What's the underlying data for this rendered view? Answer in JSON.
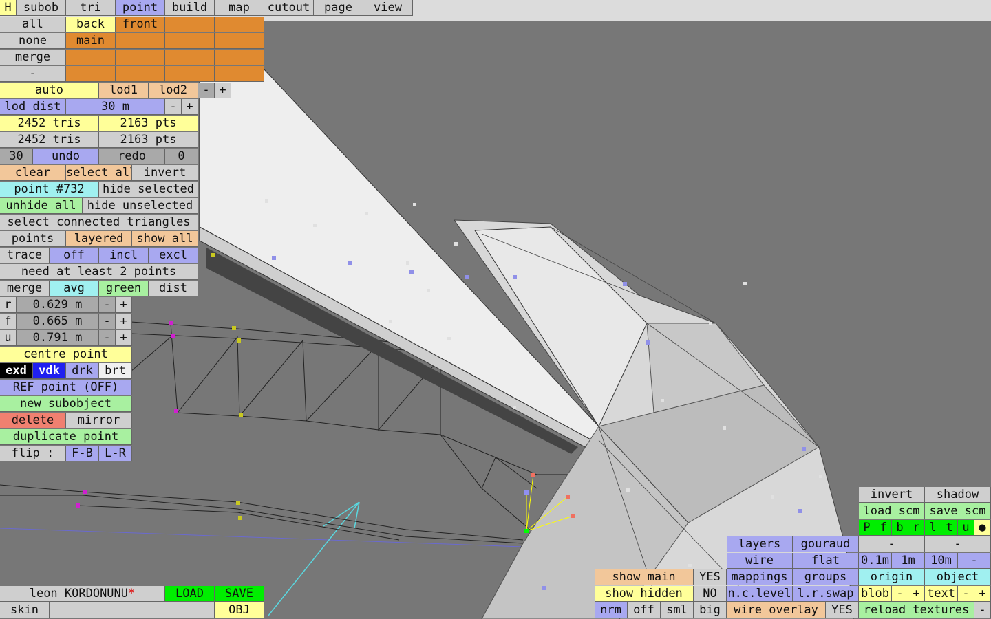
{
  "menu": [
    "H",
    "subob",
    "tri",
    "point",
    "build",
    "map",
    "cutout",
    "page",
    "view"
  ],
  "sel_panel": {
    "all": "all",
    "none": "none",
    "merge": "merge",
    "dash": "-",
    "back": "back",
    "front": "front",
    "main": "main"
  },
  "lod": {
    "auto": "auto",
    "lod1": "lod1",
    "lod2": "lod2",
    "minus": "-",
    "plus": "+"
  },
  "lod_dist": {
    "label": "lod dist",
    "value": "30 m",
    "minus": "-",
    "plus": "+"
  },
  "stats": {
    "tris1": "2452 tris",
    "pts1": "2163 pts",
    "tris2": "2452 tris",
    "pts2": "2163 pts"
  },
  "undo_row": {
    "count": "30",
    "undo": "undo",
    "redo": "redo",
    "zero": "0"
  },
  "select_row": {
    "clear": "clear",
    "select_all": "select all",
    "invert": "invert"
  },
  "point_row": {
    "point": "point #732",
    "hide_selected": "hide selected"
  },
  "unhide_row": {
    "unhide_all": "unhide all",
    "hide_unselected": "hide unselected"
  },
  "select_connected": "select connected triangles",
  "points_row": {
    "points": "points",
    "layered": "layered",
    "show_all": "show all"
  },
  "trace_row": {
    "trace": "trace",
    "off": "off",
    "incl": "incl",
    "excl": "excl"
  },
  "need_msg": "need at least 2 points",
  "merge_row": {
    "merge": "merge",
    "avg": "avg",
    "green": "green",
    "dist": "dist"
  },
  "coords": [
    {
      "axis": "r",
      "value": "0.629 m"
    },
    {
      "axis": "f",
      "value": "0.665 m"
    },
    {
      "axis": "u",
      "value": "0.791 m"
    }
  ],
  "pm": {
    "minus": "-",
    "plus": "+"
  },
  "centre_point": "centre point",
  "style_row": {
    "exd": "exd",
    "vdk": "vdk",
    "drk": "drk",
    "brt": "brt"
  },
  "ref_point": "REF point (OFF)",
  "new_subobject": "new subobject",
  "delete_row": {
    "delete": "delete",
    "mirror": "mirror"
  },
  "duplicate_point": "duplicate point",
  "flip_row": {
    "flip": "flip :",
    "fb": "F-B",
    "lr": "L-R"
  },
  "file": {
    "name": "leon KORDONUNU",
    "modified_mark": "*",
    "load": "LOAD",
    "save": "SAVE",
    "skin": "skin",
    "obj": "OBJ"
  },
  "show_panel": {
    "show_main": "show main",
    "yes": "YES",
    "show_hidden": "show hidden",
    "no": "NO",
    "nrm": "nrm",
    "off": "off",
    "sml": "sml",
    "big": "big"
  },
  "render_panel": {
    "layers": "layers",
    "gouraud": "gouraud",
    "wire": "wire",
    "flat": "flat",
    "mappings": "mappings",
    "groups": "groups",
    "nc_level": "n.c.level",
    "lr_swap": "l.r.swap",
    "wire_overlay": "wire overlay",
    "yes": "YES"
  },
  "right_panel": {
    "invert": "invert",
    "shadow": "shadow",
    "load_scm": "load scm",
    "save_scm": "save scm",
    "letters": [
      "P",
      "f",
      "b",
      "r",
      "l",
      "t",
      "u",
      "●"
    ],
    "dash1": "-",
    "dash2": "-",
    "s01": "0.1m",
    "s1": "1m",
    "s10": "10m",
    "sminus": "-",
    "origin": "origin",
    "object": "object",
    "blob": "blob",
    "text": "text",
    "minus": "-",
    "plus": "+",
    "reload": "reload textures",
    "rminus": "-"
  },
  "colors": {
    "orange": "#e08a30",
    "yellow": "#ffff99",
    "lavender": "#a8a8f0",
    "green": "#00ee00",
    "cyan": "#a0f0f0",
    "background": "#777777"
  }
}
